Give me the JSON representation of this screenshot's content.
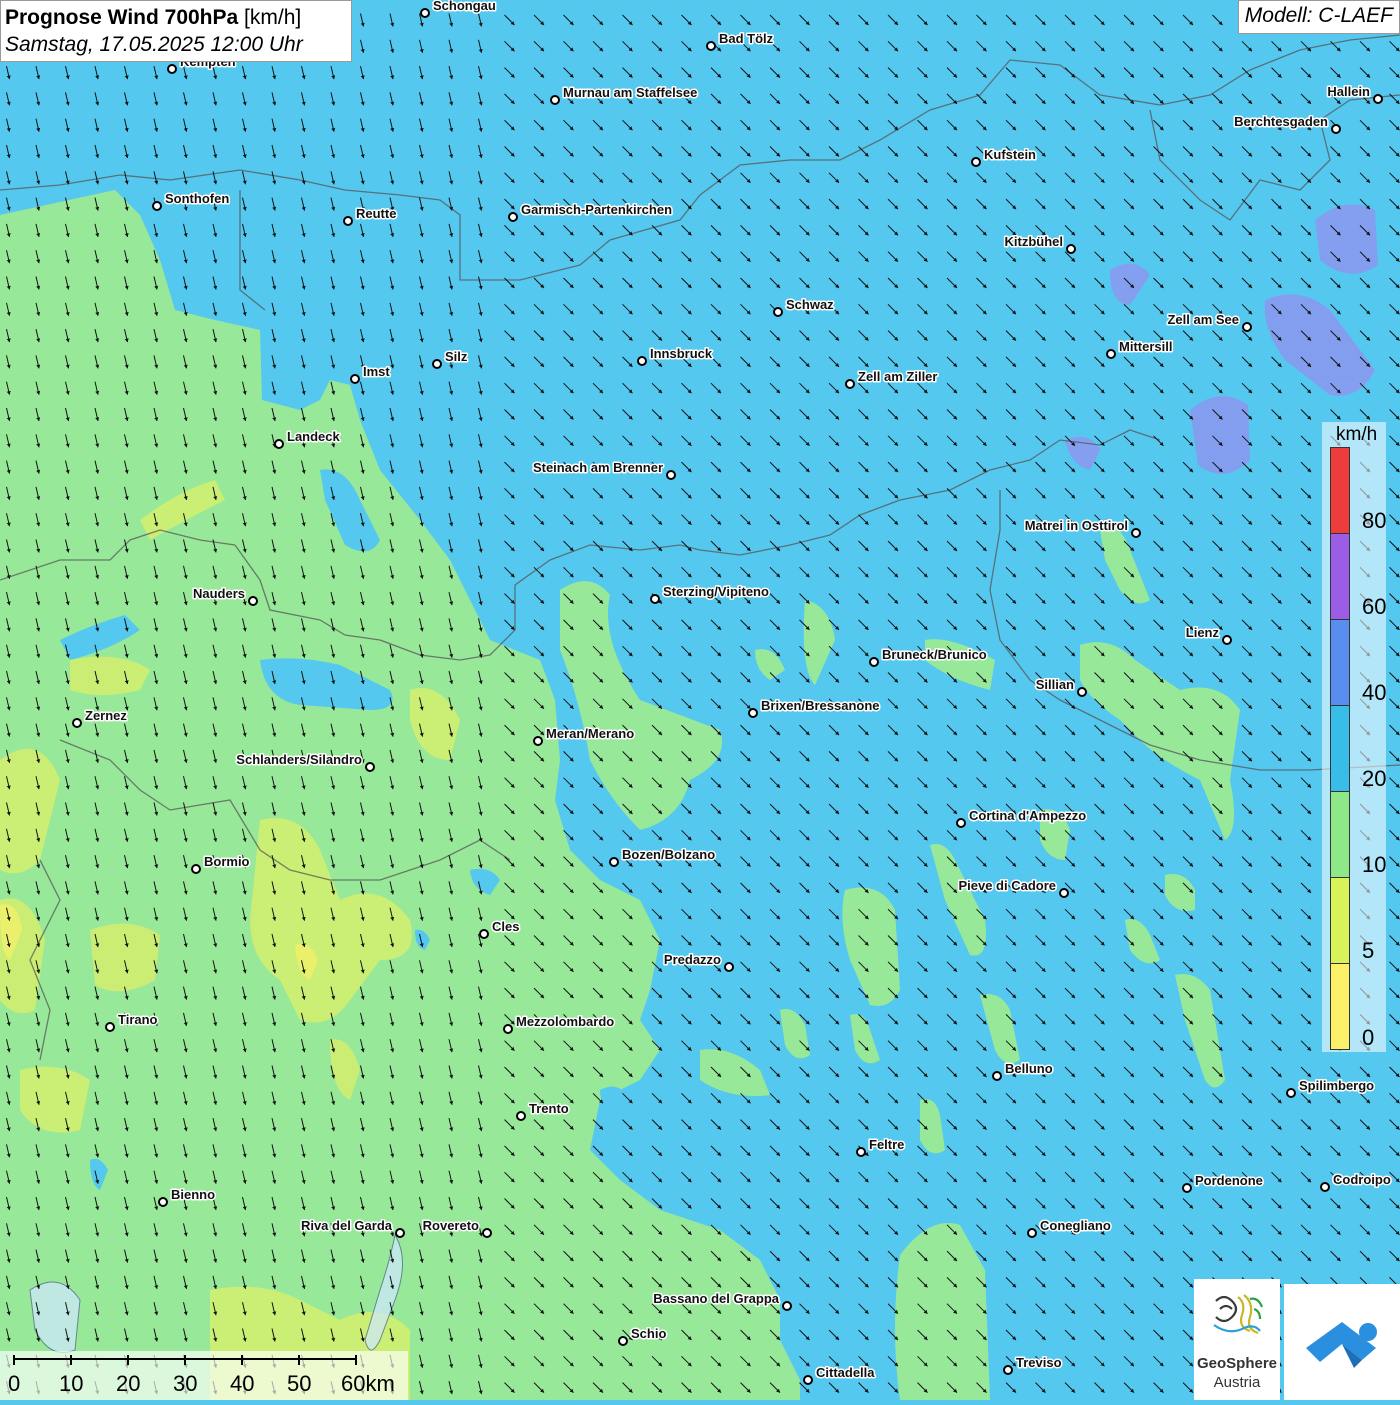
{
  "title": {
    "main": "Prognose Wind 700hPa",
    "unit": "[km/h]",
    "datetime": "Samstag, 17.05.2025 12:00 Uhr"
  },
  "model": "Modell: C-LAEF",
  "legend": {
    "unit": "km/h",
    "labels": [
      "80",
      "60",
      "40",
      "20",
      "10",
      "5",
      "0"
    ],
    "colors": [
      "#ee3b3b",
      "#9b5de5",
      "#5a8df0",
      "#38bde8",
      "#8ee887",
      "#d8f25a",
      "#fbf26a"
    ]
  },
  "scale": {
    "labels": [
      "0",
      "10",
      "20",
      "30",
      "40",
      "50",
      "60km"
    ]
  },
  "logos": {
    "geosphere_line1": "GeoSphere",
    "geosphere_line2": "Austria"
  },
  "cities": [
    {
      "name": "Schongau"
    },
    {
      "name": "Bad Tölz"
    },
    {
      "name": "Kempten"
    },
    {
      "name": "Murnau am Staffelsee"
    },
    {
      "name": "Hallein"
    },
    {
      "name": "Berchtesgaden"
    },
    {
      "name": "Kufstein"
    },
    {
      "name": "Sonthofen"
    },
    {
      "name": "Reutte"
    },
    {
      "name": "Garmisch-Partenkirchen"
    },
    {
      "name": "Kitzbühel"
    },
    {
      "name": "Schwaz"
    },
    {
      "name": "Zell am See"
    },
    {
      "name": "Mittersill"
    },
    {
      "name": "Silz"
    },
    {
      "name": "Innsbruck"
    },
    {
      "name": "Imst"
    },
    {
      "name": "Zell am Ziller"
    },
    {
      "name": "Landeck"
    },
    {
      "name": "Steinach am Brenner"
    },
    {
      "name": "Matrei in Osttirol"
    },
    {
      "name": "Nauders"
    },
    {
      "name": "Sterzing/Vipiteno"
    },
    {
      "name": "Lienz"
    },
    {
      "name": "Bruneck/Brunico"
    },
    {
      "name": "Sillian"
    },
    {
      "name": "Brixen/Bressanone"
    },
    {
      "name": "Zernez"
    },
    {
      "name": "Meran/Merano"
    },
    {
      "name": "Schlanders/Silandro"
    },
    {
      "name": "Cortina d'Ampezzo"
    },
    {
      "name": "Bozen/Bolzano"
    },
    {
      "name": "Bormio"
    },
    {
      "name": "Pieve di Cadore"
    },
    {
      "name": "Cles"
    },
    {
      "name": "Predazzo"
    },
    {
      "name": "Tirano"
    },
    {
      "name": "Mezzolombardo"
    },
    {
      "name": "Belluno"
    },
    {
      "name": "Spilimbergo"
    },
    {
      "name": "Trento"
    },
    {
      "name": "Feltre"
    },
    {
      "name": "Pordenone"
    },
    {
      "name": "Codroipo"
    },
    {
      "name": "Bienno"
    },
    {
      "name": "Riva del Garda"
    },
    {
      "name": "Rovereto"
    },
    {
      "name": "Conegliano"
    },
    {
      "name": "Bassano del Grappa"
    },
    {
      "name": "Schio"
    },
    {
      "name": "Treviso"
    },
    {
      "name": "Cittadella"
    }
  ]
}
